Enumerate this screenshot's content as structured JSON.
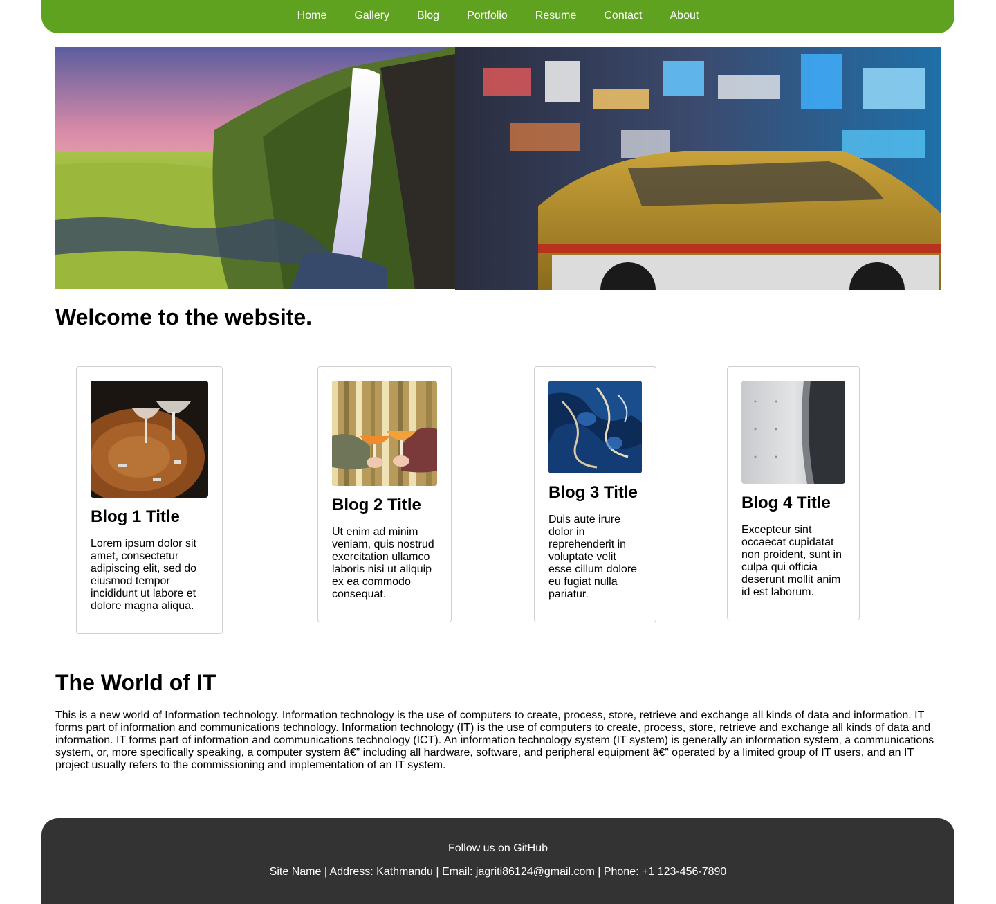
{
  "nav": {
    "items": [
      {
        "label": "Home"
      },
      {
        "label": "Gallery"
      },
      {
        "label": "Blog"
      },
      {
        "label": "Portfolio"
      },
      {
        "label": "Resume"
      },
      {
        "label": "Contact"
      },
      {
        "label": "About"
      }
    ],
    "color": "#5ea21f"
  },
  "hero": {
    "images": [
      {
        "icon": "waterfall-landscape-photo"
      },
      {
        "icon": "city-taxi-photo"
      }
    ]
  },
  "welcome": {
    "heading": "Welcome to the website."
  },
  "blogs": [
    {
      "title": "Blog 1 Title",
      "text": "Lorem ipsum dolor sit amet, consectetur adipiscing elit, sed do eiusmod tempor incididunt ut labore et dolore magna aliqua.",
      "icon": "cocktail-glasses-photo"
    },
    {
      "title": "Blog 2 Title",
      "text": "Ut enim ad minim veniam, quis nostrud exercitation ullamco laboris nisi ut aliquip ex ea commodo consequat.",
      "icon": "toast-drinks-photo"
    },
    {
      "title": "Blog 3 Title",
      "text": "Duis aute irure dolor in reprehenderit in voluptate velit esse cillum dolore eu fugiat nulla pariatur.",
      "icon": "blue-marble-photo"
    },
    {
      "title": "Blog 4 Title",
      "text": "Excepteur sint occaecat cupidatat non proident, sunt in culpa qui officia deserunt mollit anim id est laborum.",
      "icon": "concrete-wall-photo"
    }
  ],
  "it_section": {
    "title": "The World of IT",
    "text": "This is a new world of Information technology. Information technology is the use of computers to create, process, store, retrieve and exchange all kinds of data and information. IT forms part of information and communications technology. Information technology (IT) is the use of computers to create, process, store, retrieve and exchange all kinds of data and information. IT forms part of information and communications technology (ICT). An information technology system (IT system) is generally an information system, a communications system, or, more specifically speaking, a computer system â€” including all hardware, software, and peripheral equipment â€” operated by a limited group of IT users, and an IT project usually refers to the commissioning and implementation of an IT system."
  },
  "footer": {
    "follow": "Follow us on GitHub",
    "info": "Site Name | Address: Kathmandu | Email: jagriti86124@gmail.com | Phone: +1 123-456-7890",
    "color": "#333333"
  }
}
